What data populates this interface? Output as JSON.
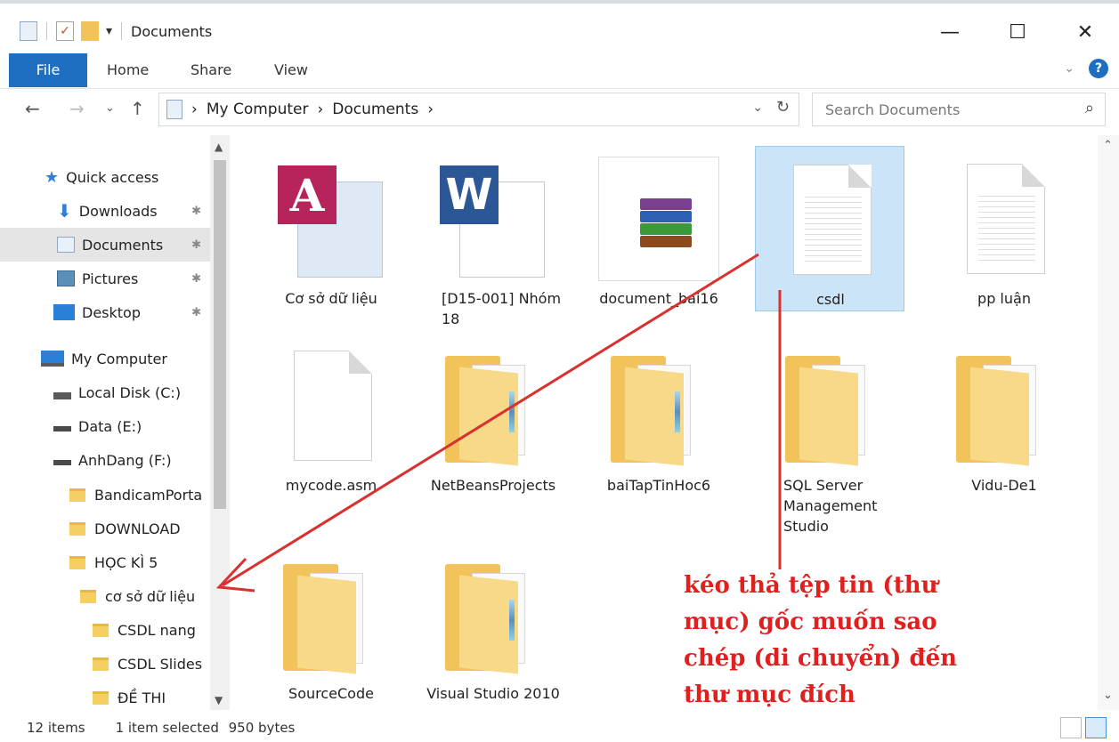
{
  "window": {
    "title": "Documents"
  },
  "ribbon": {
    "tabs": [
      "File",
      "Home",
      "Share",
      "View"
    ]
  },
  "address": {
    "crumbs": [
      "My Computer",
      "Documents"
    ],
    "search_placeholder": "Search Documents"
  },
  "nav": {
    "quick_access": "Quick access",
    "items": [
      {
        "label": "Downloads",
        "pinned": true
      },
      {
        "label": "Documents",
        "pinned": true,
        "selected": true
      },
      {
        "label": "Pictures",
        "pinned": true
      },
      {
        "label": "Desktop",
        "pinned": true
      }
    ],
    "computer": "My Computer",
    "drives": [
      "Local Disk (C:)",
      "Data (E:)",
      "AnhDang (F:)"
    ],
    "folders": [
      "BandicamPorta",
      "DOWNLOAD",
      "HỌC KÌ 5",
      "cơ sở dữ liệu",
      "CSDL nang",
      "CSDL Slides",
      "ĐỀ THI"
    ]
  },
  "files": [
    {
      "name": "Cơ sở dữ liệu",
      "kind": "access"
    },
    {
      "name": "[D15-001] Nhóm 18",
      "kind": "word"
    },
    {
      "name": "document_bai16",
      "kind": "rar"
    },
    {
      "name": "csdl",
      "kind": "text",
      "selected": true
    },
    {
      "name": "pp luận",
      "kind": "text"
    },
    {
      "name": "mycode.asm",
      "kind": "blank"
    },
    {
      "name": "NetBeansProjects",
      "kind": "folder"
    },
    {
      "name": "baiTapTinHoc6",
      "kind": "folder"
    },
    {
      "name": "SQL Server Management Studio",
      "kind": "folder"
    },
    {
      "name": "Vidu-De1",
      "kind": "folder"
    },
    {
      "name": "SourceCode",
      "kind": "folder"
    },
    {
      "name": "Visual Studio 2010",
      "kind": "folder"
    }
  ],
  "status": {
    "count": "12 items",
    "selection": "1 item selected",
    "size": "950 bytes"
  },
  "annotation": {
    "lines": [
      "kéo thả tệp tin (thư",
      "mục) gốc muốn sao",
      "chép (di chuyển) đến",
      "thư mục đích"
    ],
    "color": "#e01f1f"
  },
  "colors": {
    "accent": "#1e6fc1",
    "selection": "#cce4f7",
    "folder": "#f2c35a"
  }
}
